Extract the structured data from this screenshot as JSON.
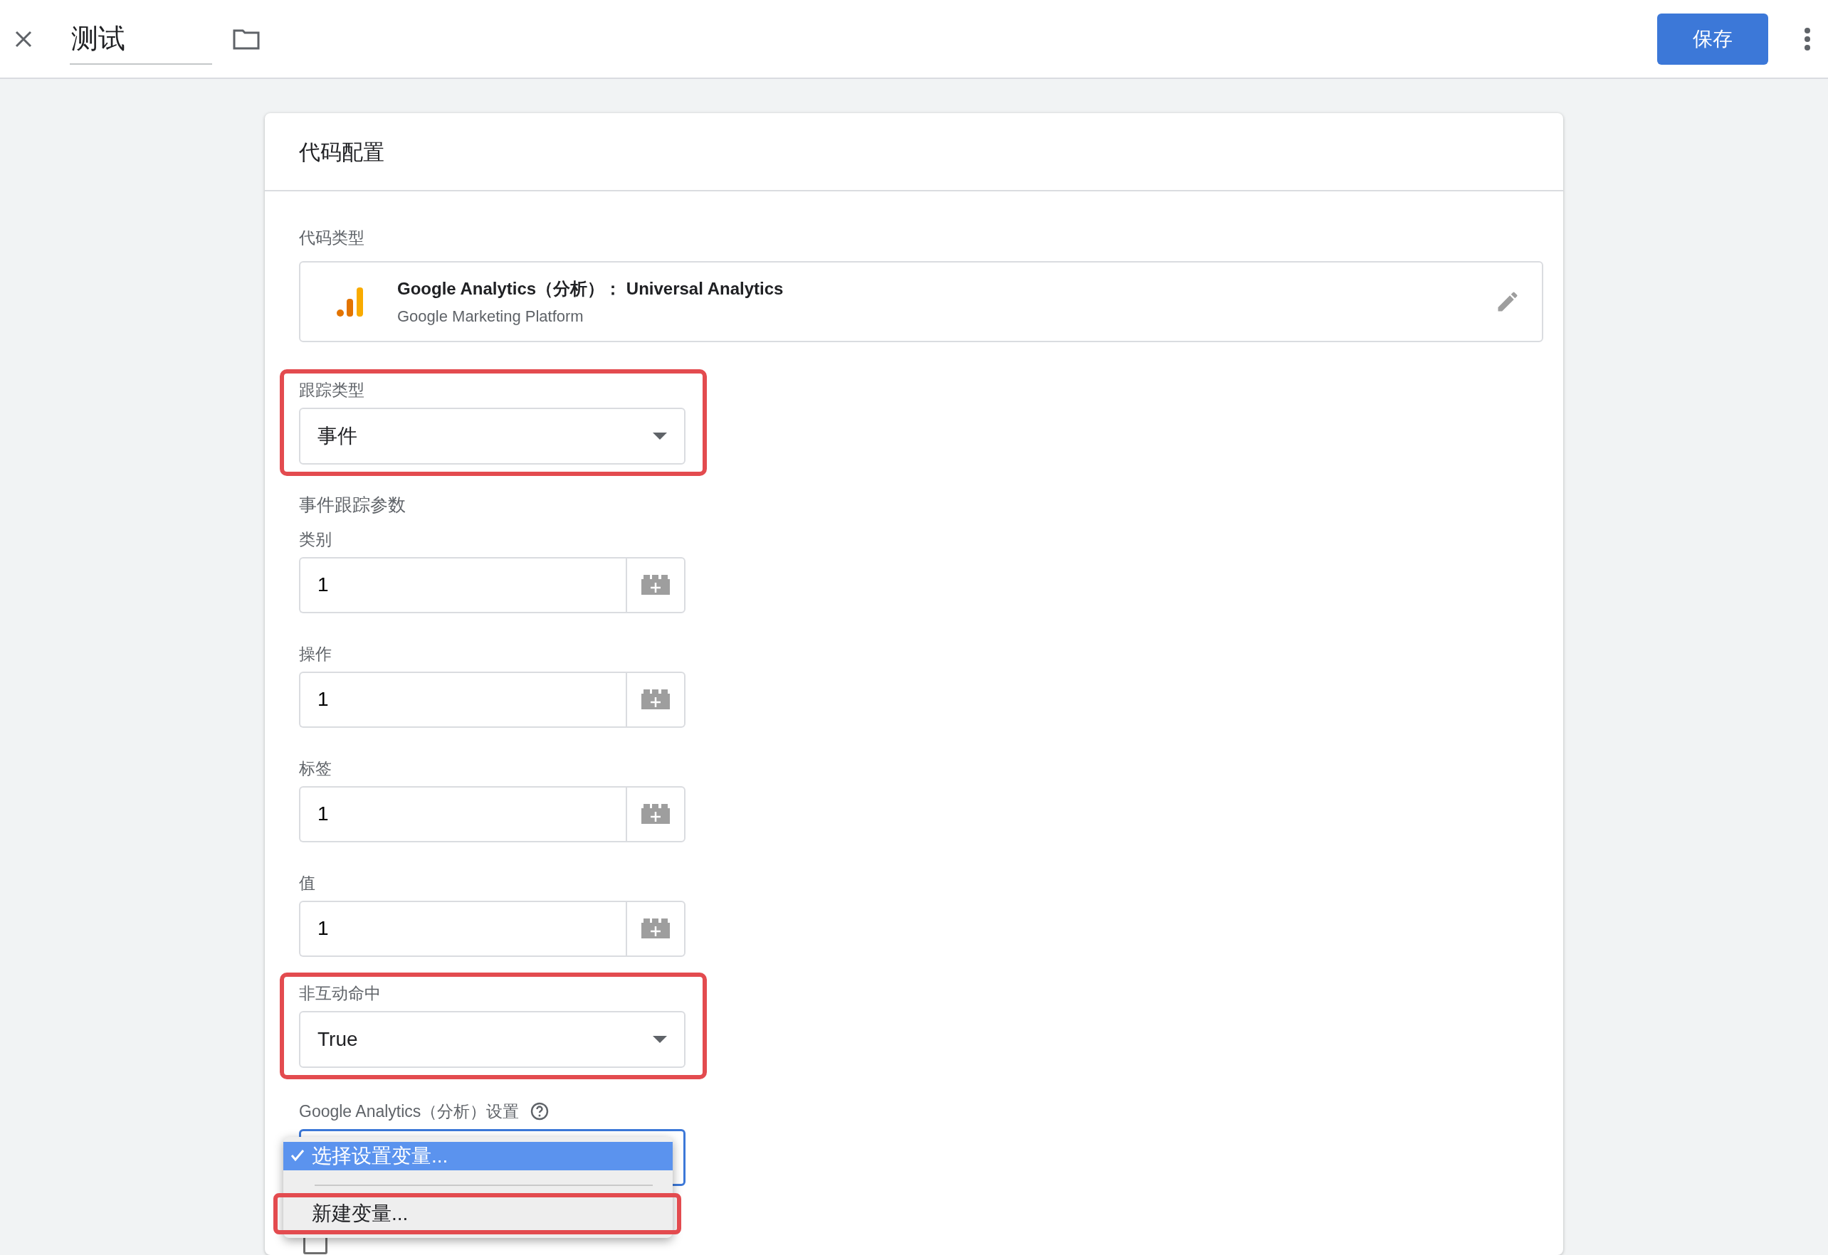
{
  "top_bar": {
    "title": "测试",
    "save_button": "保存"
  },
  "card": {
    "title": "代码配置",
    "tag_type": {
      "label": "代码类型",
      "name": "Google Analytics（分析）： Universal Analytics",
      "vendor": "Google Marketing Platform"
    },
    "fields": [
      {
        "kind": "select",
        "label": "跟踪类型",
        "value": "事件",
        "highlighted": true
      },
      {
        "kind": "heading",
        "label": "事件跟踪参数"
      },
      {
        "kind": "text",
        "label": "类别",
        "value": "1"
      },
      {
        "kind": "text",
        "label": "操作",
        "value": "1"
      },
      {
        "kind": "text",
        "label": "标签",
        "value": "1"
      },
      {
        "kind": "text",
        "label": "值",
        "value": "1"
      },
      {
        "kind": "select",
        "label": "非互动命中",
        "value": "True",
        "highlighted": true
      },
      {
        "kind": "variable_select",
        "label": "Google Analytics（分析）设置",
        "focused": true
      }
    ],
    "override_checkbox": {
      "checked": false
    }
  },
  "menu": {
    "items": [
      {
        "label": "选择设置变量...",
        "selected": true,
        "highlighted": false
      },
      {
        "label": "新建变量...",
        "selected": false,
        "highlighted": true
      }
    ]
  }
}
